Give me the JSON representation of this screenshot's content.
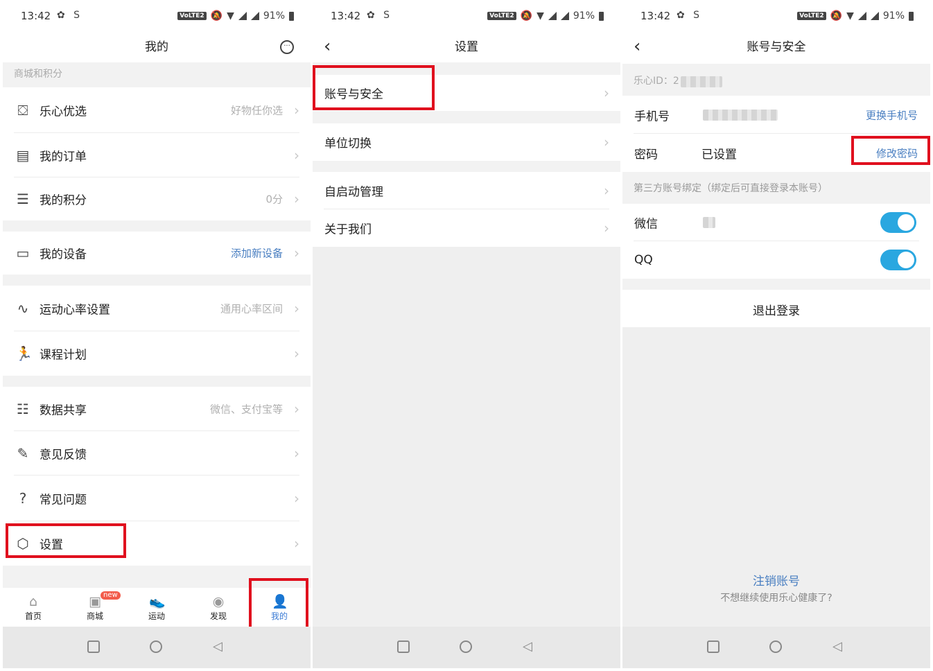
{
  "status": {
    "time": "13:42",
    "battery": "91%",
    "volte": "VoLTE2"
  },
  "screen1": {
    "title": "我的",
    "section_label": "商城和积分",
    "items": [
      {
        "label": "乐心优选",
        "hint": "好物任你选"
      },
      {
        "label": "我的订单",
        "hint": ""
      },
      {
        "label": "我的积分",
        "hint": "0分"
      },
      {
        "label": "我的设备",
        "hint": "添加新设备"
      },
      {
        "label": "运动心率设置",
        "hint": "通用心率区间"
      },
      {
        "label": "课程计划",
        "hint": ""
      },
      {
        "label": "数据共享",
        "hint": "微信、支付宝等"
      },
      {
        "label": "意见反馈",
        "hint": ""
      },
      {
        "label": "常见问题",
        "hint": ""
      },
      {
        "label": "设置",
        "hint": ""
      }
    ],
    "tabs": [
      {
        "label": "首页"
      },
      {
        "label": "商城",
        "badge": "new"
      },
      {
        "label": "运动"
      },
      {
        "label": "发现"
      },
      {
        "label": "我的"
      }
    ]
  },
  "screen2": {
    "title": "设置",
    "items": [
      {
        "label": "账号与安全"
      },
      {
        "label": "单位切换"
      },
      {
        "label": "自启动管理"
      },
      {
        "label": "关于我们"
      }
    ]
  },
  "screen3": {
    "title": "账号与安全",
    "id_label": "乐心ID：2",
    "phone_label": "手机号",
    "phone_action": "更换手机号",
    "password_label": "密码",
    "password_value": "已设置",
    "password_action": "修改密码",
    "third_party_label": "第三方账号绑定（绑定后可直接登录本账号）",
    "wechat_label": "微信",
    "qq_label": "QQ",
    "logout": "退出登录",
    "cancel_account": "注销账号",
    "cancel_hint": "不想继续使用乐心健康了?"
  },
  "colors": {
    "highlight": "#e0101e",
    "accent_blue": "#3a7bd5",
    "toggle": "#2aa7e0"
  },
  "icons": [
    "message-icon",
    "shop-bag-icon",
    "order-icon",
    "coins-icon",
    "device-icon",
    "heart-rate-icon",
    "running-icon",
    "share-icon",
    "feedback-icon",
    "faq-icon",
    "settings-icon",
    "home-icon",
    "mall-icon",
    "shoe-icon",
    "compass-icon",
    "user-icon"
  ]
}
